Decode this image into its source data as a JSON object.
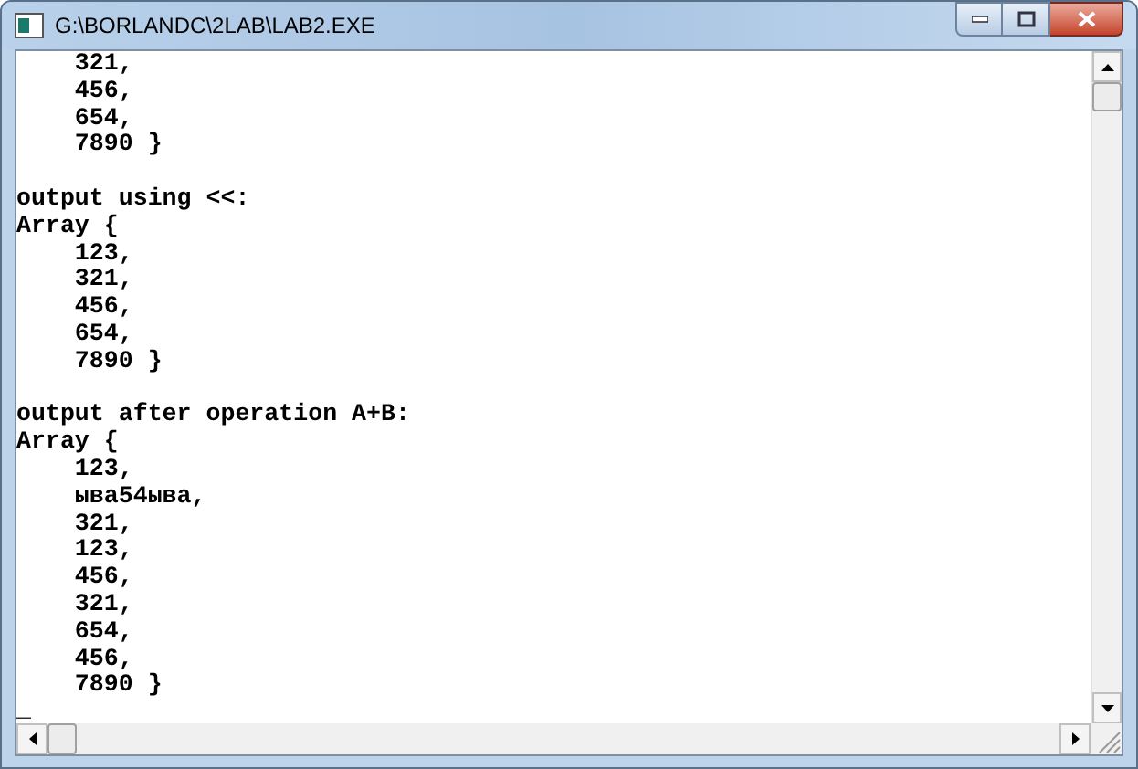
{
  "window": {
    "title": "G:\\BORLANDC\\2LAB\\LAB2.EXE"
  },
  "console": {
    "blocks": [
      {
        "lines": [
          "    321,",
          "    456,",
          "    654,",
          "    7890 }"
        ]
      },
      {
        "lines": [
          "output using <<:",
          "Array {",
          "    123,",
          "    321,",
          "    456,",
          "    654,",
          "    7890 }"
        ]
      },
      {
        "lines": [
          "output after operation A+B:",
          "Array {",
          "    123,",
          "    ыва54ыва,",
          "    321,",
          "    123,",
          "    456,",
          "    321,",
          "    654,",
          "    456,",
          "    7890 }"
        ]
      }
    ],
    "cursor": "_"
  }
}
